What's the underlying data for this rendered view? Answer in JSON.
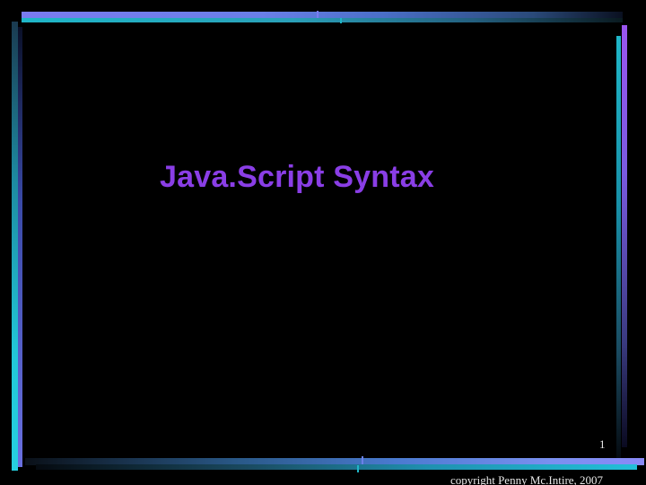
{
  "slide": {
    "title": "Java.Script Syntax",
    "page_number": "1",
    "footer": "copyright Penny Mc.Intire, 2007"
  },
  "colors": {
    "background": "#000000",
    "title": "#8a3ee6",
    "accent_cyan": "#1fb6c8",
    "accent_violet": "#7a7bf0",
    "footer_text": "#e8e8e8"
  }
}
